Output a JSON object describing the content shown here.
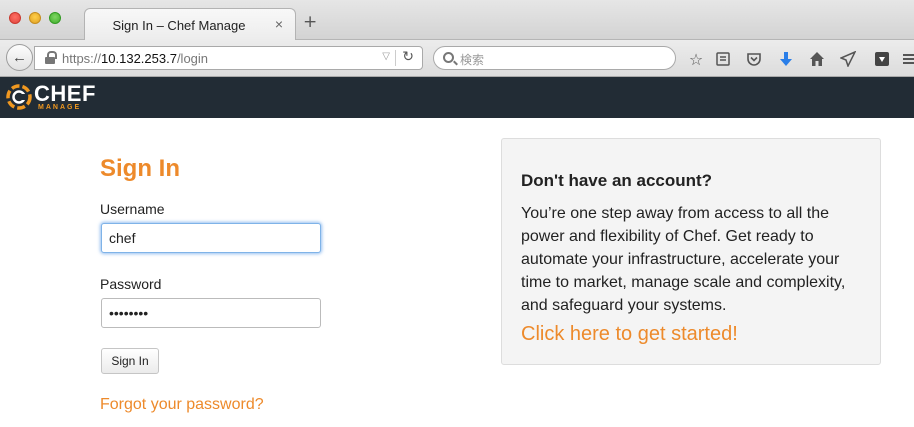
{
  "browser": {
    "tab_title": "Sign In – Chef Manage",
    "tab_close": "×",
    "new_tab": "+",
    "url_scheme": "https://",
    "url_host": "10.132.253.7",
    "url_path": "/login",
    "search_placeholder": "検索",
    "icons": [
      "back-arrow-icon",
      "lock-icon",
      "dropdown-icon",
      "reload-icon",
      "search-icon",
      "star-icon",
      "reading-list-icon",
      "pocket-icon",
      "download-icon",
      "home-icon",
      "send-icon",
      "save-icon",
      "menu-icon"
    ]
  },
  "header": {
    "logo_word": "CHEF",
    "logo_sub": "MANAGE",
    "brand_color": "#ed8a2b",
    "bar_color": "#222c35"
  },
  "signin": {
    "title": "Sign In",
    "username_label": "Username",
    "username_value": "chef",
    "password_label": "Password",
    "password_value": "••••••••",
    "submit_label": "Sign In",
    "forgot_label": "Forgot your password?"
  },
  "panel": {
    "heading": "Don't have an account?",
    "body": "You’re one step away from access to all the power and flexibility of Chef. Get ready to automate your infrastructure, accelerate your time to market, manage scale and complexity, and safeguard your systems.",
    "cta": "Click here to get started!"
  }
}
